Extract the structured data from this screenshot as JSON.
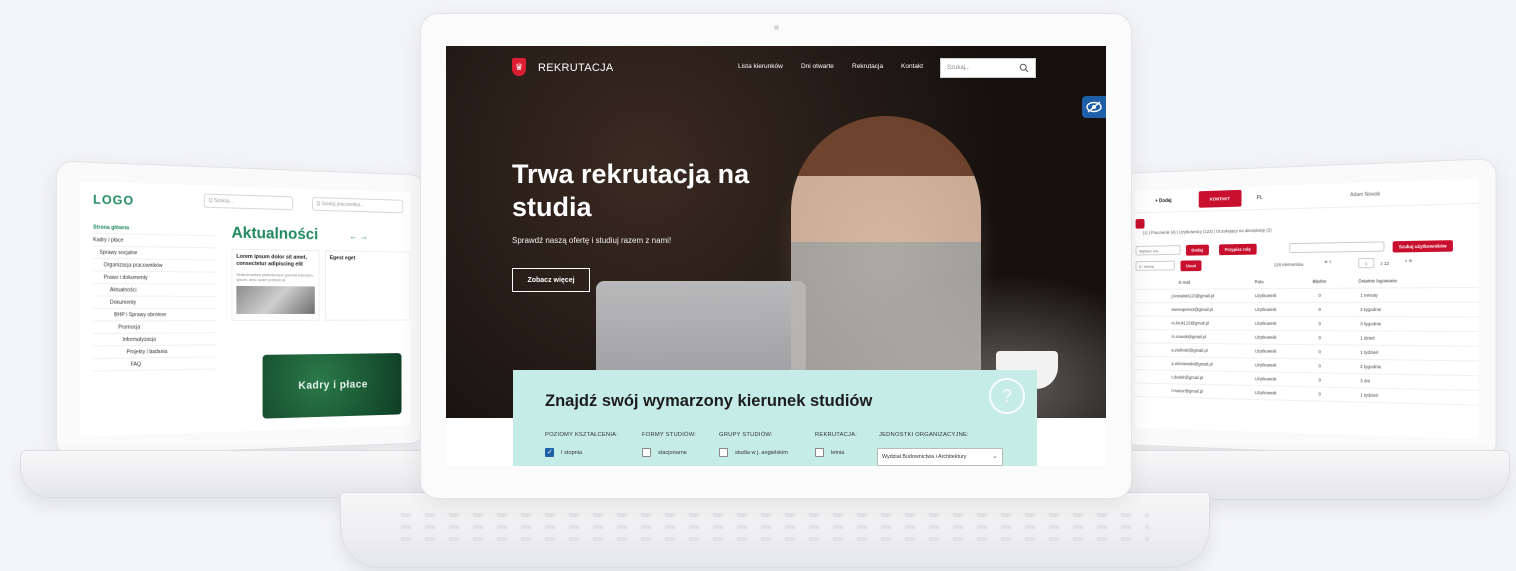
{
  "left_app": {
    "logo": "LOGO",
    "search_placeholder": "Q Szukaj...",
    "search_people_placeholder": "Q Szukaj pracownika...",
    "nav": [
      "Strona główna",
      "Kadry i płace",
      "Sprawy socjalne",
      "Organizacja pracowników",
      "Prawo i dokumenty",
      "Aktualności",
      "Dokumenty",
      "BHP i Sprawy obronne",
      "Promocja",
      "Informatyzacja",
      "Projekty i badania",
      "FAQ"
    ],
    "news_title": "Aktualności",
    "news_arrows": "← →",
    "news_card_title": "Lorem ipsum dolor sit amet, consectetur adipiscing elit",
    "news_card_text": "Nulla tincidunt pellentesque gravida interdum. Ipsum, arcu quam pretium id.",
    "news_card2_title": "Egest eget",
    "banner_text": "Kadry i płace"
  },
  "right_app": {
    "add_label": "+ Dodaj",
    "active_tab": "KONTAKT",
    "lang": "PL",
    "user": "Adam Nowak",
    "tabs": "(1) | Pracownik (4) | Użytkownicy (123) | Oczekujący na akceptację (2)",
    "filter_placeholder": "Wybierz ma...",
    "btn_add": "Dodaj",
    "btn_assign": "Przypisz rolę",
    "btn_search": "Szukaj użytkowników",
    "per_page": "5 / stronę",
    "btn_delete": "Usuń",
    "count": "128 elementów",
    "page_current": "1",
    "page_total": "z 12",
    "columns": [
      "E-mail",
      "Rola",
      "Błędne",
      "Ostatnie logowanie"
    ],
    "rows": [
      [
        "j.kowalski123@gmail.pl",
        "Użytkownik",
        "0",
        "1 minutę"
      ],
      [
        "ewenajems3@gmail.pl",
        "Użytkownik",
        "0",
        "2 tygodnie"
      ],
      [
        "m.kruk123@gmail.pl",
        "Użytkownik",
        "0",
        "3 tygodnie"
      ],
      [
        "m.nowak@gmail.pl",
        "Użytkownik",
        "0",
        "1 dzień"
      ],
      [
        "a.zielinski@gmail.pl",
        "Użytkownik",
        "0",
        "1 tydzień"
      ],
      [
        "p.wiśniewski@gmail.pl",
        "Użytkownik",
        "0",
        "2 tygodnie"
      ],
      [
        "t.dudek@gmail.pl",
        "Użytkownik",
        "0",
        "3 dni"
      ],
      [
        "l.mazur@gmail.pl",
        "Użytkownik",
        "0",
        "1 tydzień"
      ]
    ]
  },
  "center_app": {
    "brand": "REKRUTACJA",
    "menu": [
      "Lista kierunków",
      "Dni otwarte",
      "Rekrutacja",
      "Kontakt"
    ],
    "search_placeholder": "Szukaj...",
    "hero_title": "Trwa rekrutacja na studia",
    "hero_subtitle": "Sprawdź naszą ofertę i studiuj razem z nami!",
    "hero_button": "Zobacz więcej",
    "finder_title": "Znajdź swój wymarzony kierunek studiów",
    "finder_columns": [
      "POZIOMY KSZTAŁCENIA:",
      "FORMY STUDIÓW:",
      "GRUPY STUDIÓW:",
      "REKRUTACJA:",
      "JEDNOSTKI ORGANIZACYJNE:"
    ],
    "options": {
      "level": "I stopnia",
      "form": "stacjonarne",
      "group": "studia w j. angielskim",
      "recruitment": "letnia"
    },
    "unit_select": "Wydział Budownictwa i Architektury",
    "colors": {
      "accent": "#1f5fa8",
      "finder_bg": "#c6ece7",
      "emblem": "#dc1e35"
    }
  }
}
